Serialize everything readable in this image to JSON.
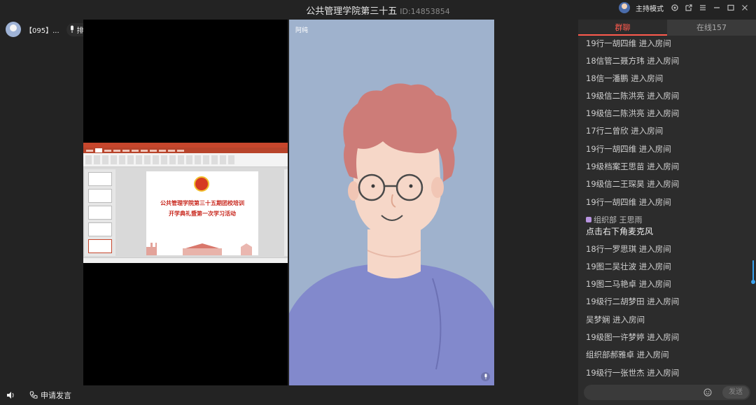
{
  "window": {
    "title": "公共管理学院第三十五",
    "room_id": "ID:14853854",
    "host_mode_label": "主持模式"
  },
  "user": {
    "name": "【095】..."
  },
  "queue": {
    "label": "排麦"
  },
  "video": {
    "participant_name": "阿纯"
  },
  "slide": {
    "title_line1": "公共管理学院第三十五期团校培训",
    "title_line2": "开学典礼暨第一次学习活动"
  },
  "bottom": {
    "apply_label": "申请发言"
  },
  "panel": {
    "tabs": [
      {
        "label": "群聊",
        "active": true
      },
      {
        "label": "在线157",
        "active": false
      }
    ],
    "messages": [
      {
        "type": "join",
        "text": "19行一胡四维 进入房间"
      },
      {
        "type": "join",
        "text": "18信管二聂方玮 进入房间"
      },
      {
        "type": "join",
        "text": "18信一潘鹏 进入房间"
      },
      {
        "type": "join",
        "text": "19级信二陈洪亮 进入房间"
      },
      {
        "type": "join",
        "text": "19级信二陈洪亮 进入房间"
      },
      {
        "type": "join",
        "text": "17行二曾欣 进入房间"
      },
      {
        "type": "join",
        "text": "19行一胡四维 进入房间"
      },
      {
        "type": "join",
        "text": "19级档案王思苗 进入房间"
      },
      {
        "type": "join",
        "text": "19级信二王琛昊 进入房间"
      },
      {
        "type": "join",
        "text": "19行一胡四维 进入房间"
      },
      {
        "type": "sender",
        "text": "组织部 王思雨"
      },
      {
        "type": "text",
        "text": "点击右下角麦克风"
      },
      {
        "type": "join",
        "text": "18行一罗思琪 进入房间"
      },
      {
        "type": "join",
        "text": "19图二吴壮波 进入房间"
      },
      {
        "type": "join",
        "text": "19图二马艳卓 进入房间"
      },
      {
        "type": "join",
        "text": "19级行二胡梦田 进入房间"
      },
      {
        "type": "join",
        "text": "吴梦娴 进入房间"
      },
      {
        "type": "join",
        "text": "19级图一许梦婷 进入房间"
      },
      {
        "type": "join",
        "text": "组织部郝雅卓 进入房间"
      },
      {
        "type": "join",
        "text": "19级行一张世杰 进入房间"
      }
    ],
    "send_label": "发送"
  },
  "colors": {
    "accent": "#ff5a4e",
    "scroll": "#3aa2ef",
    "video_bg": "#9fb2cd",
    "sweater": "#8289cc",
    "hair": "#cd7c78",
    "skin": "#f6d7c8"
  }
}
